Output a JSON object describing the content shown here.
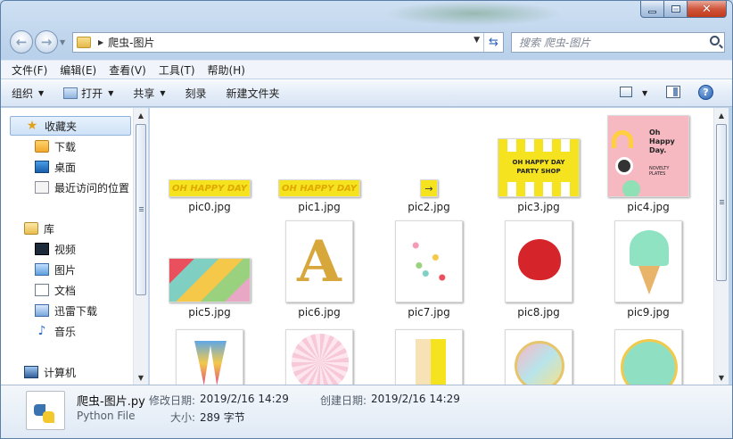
{
  "window": {
    "minimize_glyph": "—",
    "maximize_glyph": "□",
    "close_glyph": "✕"
  },
  "navigation": {
    "breadcrumb": "爬虫-图片",
    "search_placeholder": "搜索 爬虫-图片"
  },
  "menu": [
    "文件(F)",
    "编辑(E)",
    "查看(V)",
    "工具(T)",
    "帮助(H)"
  ],
  "commands": {
    "organize": "组织",
    "open": "打开",
    "share": "共享",
    "burn": "刻录",
    "new_folder": "新建文件夹"
  },
  "sidebar": {
    "favorites_header": "收藏夹",
    "favorites": [
      "下载",
      "桌面",
      "最近访问的位置"
    ],
    "libraries_header": "库",
    "libraries": [
      "视频",
      "图片",
      "文档",
      "迅雷下载",
      "音乐"
    ],
    "computer": "计算机"
  },
  "files": [
    {
      "name": "pic0.jpg",
      "thumb_text": "OH HAPPY DAY"
    },
    {
      "name": "pic1.jpg",
      "thumb_text": "OH HAPPY DAY"
    },
    {
      "name": "pic2.jpg",
      "thumb_text": "→"
    },
    {
      "name": "pic3.jpg",
      "thumb_text": "OH HAPPY DAY PARTY SHOP"
    },
    {
      "name": "pic4.jpg",
      "thumb_text": "Oh Happy Day.",
      "thumb_text_2": "NOVELTY PLATES"
    },
    {
      "name": "pic5.jpg"
    },
    {
      "name": "pic6.jpg",
      "thumb_text": "A"
    },
    {
      "name": "pic7.jpg"
    },
    {
      "name": "pic8.jpg"
    },
    {
      "name": "pic9.jpg"
    }
  ],
  "details": {
    "file_name": "爬虫-图片.py",
    "file_type": "Python File",
    "modified_label": "修改日期:",
    "modified_value": "2019/2/16 14:29",
    "created_label": "创建日期:",
    "created_value": "2019/2/16 14:29",
    "size_label": "大小:",
    "size_value": "289 字节"
  },
  "colors": {
    "selection_blue": "#cfe2f7",
    "banner_yellow": "#f5e31f",
    "close_red": "#c23a1c"
  }
}
